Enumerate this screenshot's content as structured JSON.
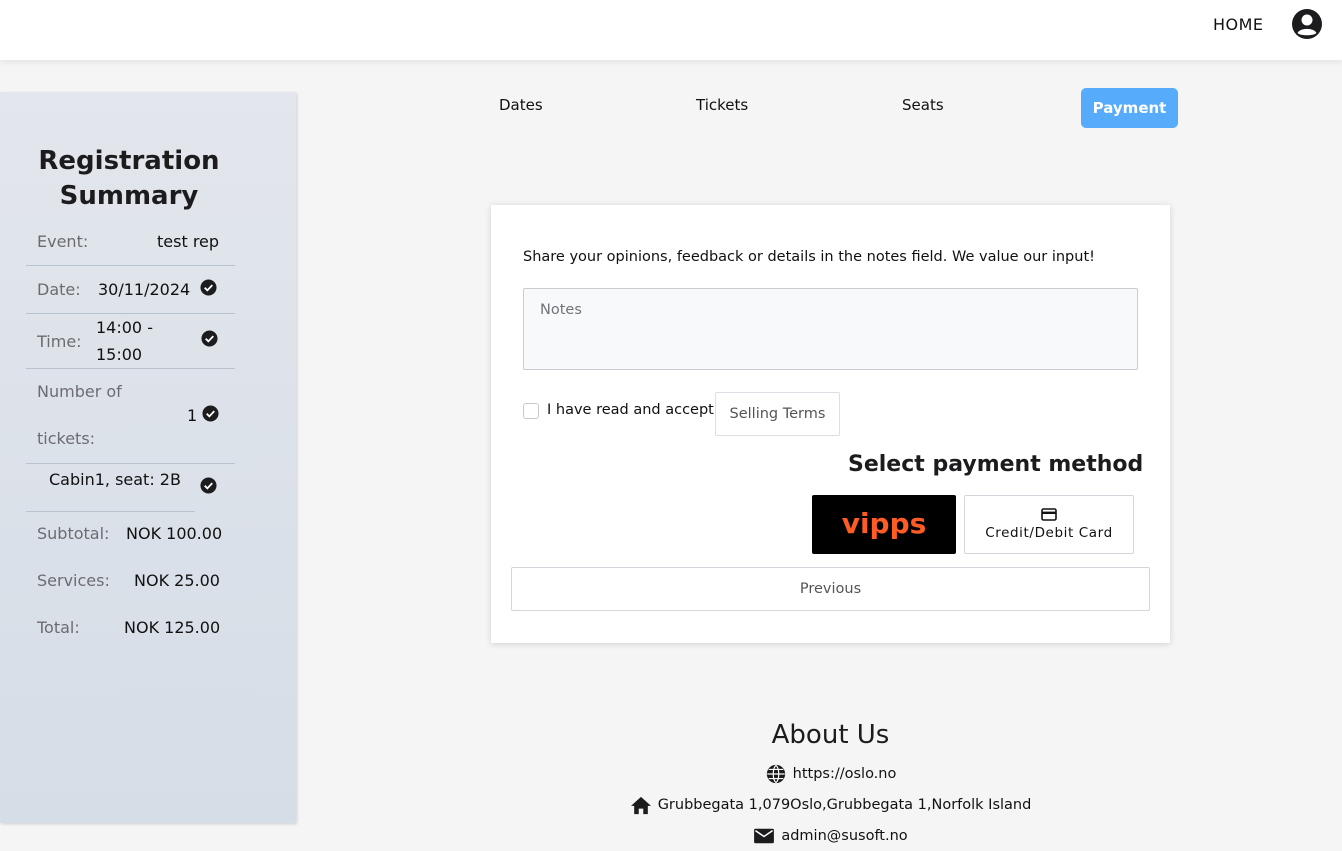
{
  "nav": {
    "home_label": "HOME",
    "user_icon": "user-circle-icon"
  },
  "summary": {
    "title": "Registration Summary",
    "event": {
      "label": "Event:",
      "value": "test rep"
    },
    "date": {
      "label": "Date:",
      "value": "30/11/2024"
    },
    "time": {
      "label": "Time:",
      "value_line1": "14:00 -",
      "value_line2": "15:00"
    },
    "tickets": {
      "label_line1": "Number of",
      "label_line2": "tickets:",
      "value": "1"
    },
    "seat": {
      "value": "Cabin1, seat: 2B"
    },
    "subtotal": {
      "label": "Subtotal:",
      "value": "NOK 100.00"
    },
    "services": {
      "label": "Services:",
      "value": "NOK 25.00"
    },
    "total": {
      "label": "Total:",
      "value": "NOK 125.00"
    }
  },
  "steps": {
    "dates": "Dates",
    "tickets": "Tickets",
    "seats": "Seats",
    "payment": "Payment",
    "active_color": "#56acfb"
  },
  "form": {
    "intro": "Share your opinions, feedback or details in the notes field. We value our input!",
    "notes_placeholder": "Notes",
    "terms_text": "I have read and accept",
    "terms_link": "Selling Terms",
    "payment_title": "Select payment method",
    "vipps_label": "vipps",
    "vipps_color": "#ff5b24",
    "card_label": "Credit/Debit Card",
    "previous_label": "Previous"
  },
  "footer": {
    "title": "About Us",
    "website": "https://oslo.no",
    "address": "Grubbegata 1,079Oslo,Grubbegata 1,Norfolk Island",
    "email": "admin@susoft.no"
  }
}
